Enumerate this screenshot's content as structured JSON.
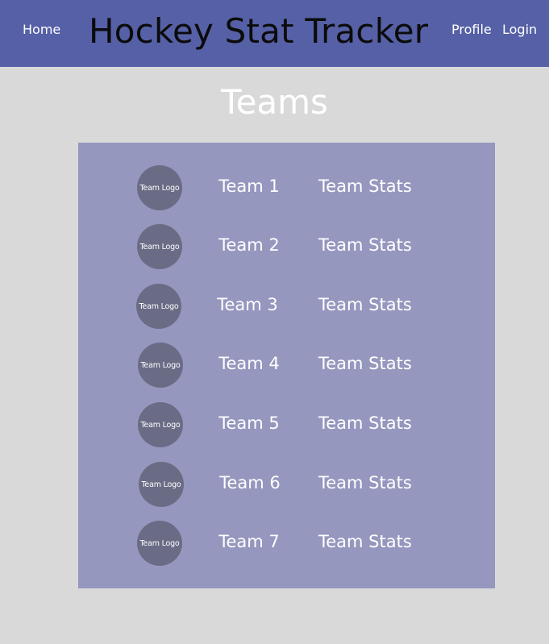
{
  "header": {
    "home_label": "Home",
    "app_title": "Hockey Stat Tracker",
    "profile_label": "Profile",
    "login_label": "Login"
  },
  "page": {
    "heading": "Teams"
  },
  "teams": [
    {
      "logo_text": "Team Logo",
      "name": "Team 1",
      "stats_label": "Team Stats"
    },
    {
      "logo_text": "Team Logo",
      "name": "Team 2",
      "stats_label": "Team Stats"
    },
    {
      "logo_text": "Team Logo",
      "name": "Team 3",
      "stats_label": "Team Stats"
    },
    {
      "logo_text": "Team Logo",
      "name": "Team 4",
      "stats_label": "Team Stats"
    },
    {
      "logo_text": "Team Logo",
      "name": "Team 5",
      "stats_label": "Team Stats"
    },
    {
      "logo_text": "Team Logo",
      "name": "Team 6",
      "stats_label": "Team Stats"
    },
    {
      "logo_text": "Team Logo",
      "name": "Team 7",
      "stats_label": "Team Stats"
    }
  ],
  "colors": {
    "header_bg": "#5560a6",
    "page_bg": "#d9d9d9",
    "panel_bg": "#9597be",
    "logo_bg": "#6a6c86",
    "text_light": "#ffffff",
    "title_text": "#0b0b0b"
  }
}
